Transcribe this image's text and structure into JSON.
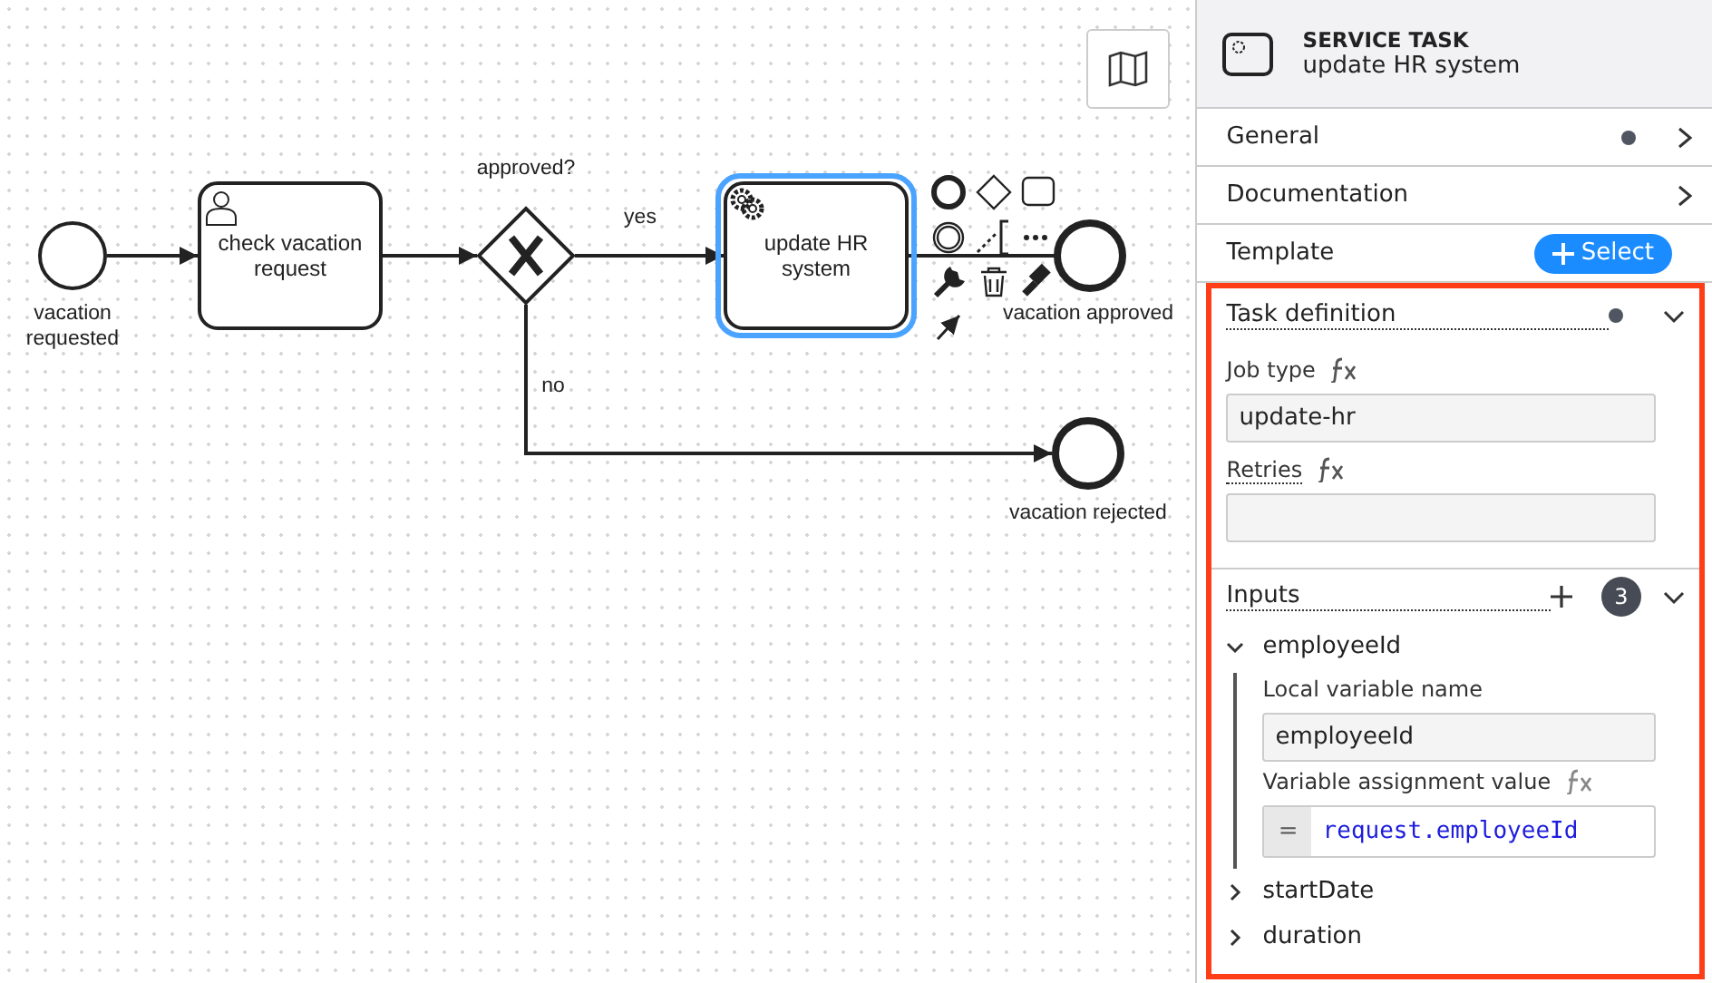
{
  "diagram": {
    "labels": [
      {
        "kind": "start",
        "text": "vacation requested"
      },
      {
        "kind": "user_task",
        "text": "check vacation request"
      },
      {
        "kind": "gateway",
        "text": "approved?"
      },
      {
        "kind": "flow_yes",
        "text": "yes"
      },
      {
        "kind": "service_task",
        "text": "update HR system",
        "selected": true
      },
      {
        "kind": "end_approved",
        "text": "vacation approved"
      },
      {
        "kind": "flow_no",
        "text": "no"
      },
      {
        "kind": "end_rejected",
        "text": "vacation rejected"
      }
    ]
  },
  "panel": {
    "header": {
      "type": "SERVICE TASK",
      "name": "update HR system"
    },
    "groups": [
      {
        "label": "General",
        "dot": true
      },
      {
        "label": "Documentation",
        "dot": false
      }
    ],
    "template": {
      "label": "Template",
      "button": "Select"
    },
    "task_definition": {
      "title": "Task definition",
      "dot": true,
      "expanded": true,
      "fields": [
        {
          "label": "Job type",
          "value": "update-hr"
        },
        {
          "label": "Retries"
        }
      ]
    },
    "inputs": {
      "title": "Inputs",
      "count": "3",
      "expanded": true,
      "items": [
        {
          "name": "employeeId",
          "expanded": true,
          "local_label": "Local variable name",
          "local_value": "employeeId",
          "assign_label": "Variable assignment value",
          "assign_prefix": "=",
          "assign_value": "request.employeeId"
        },
        {
          "name": "startDate",
          "expanded": false
        },
        {
          "name": "duration",
          "expanded": false
        }
      ]
    }
  }
}
